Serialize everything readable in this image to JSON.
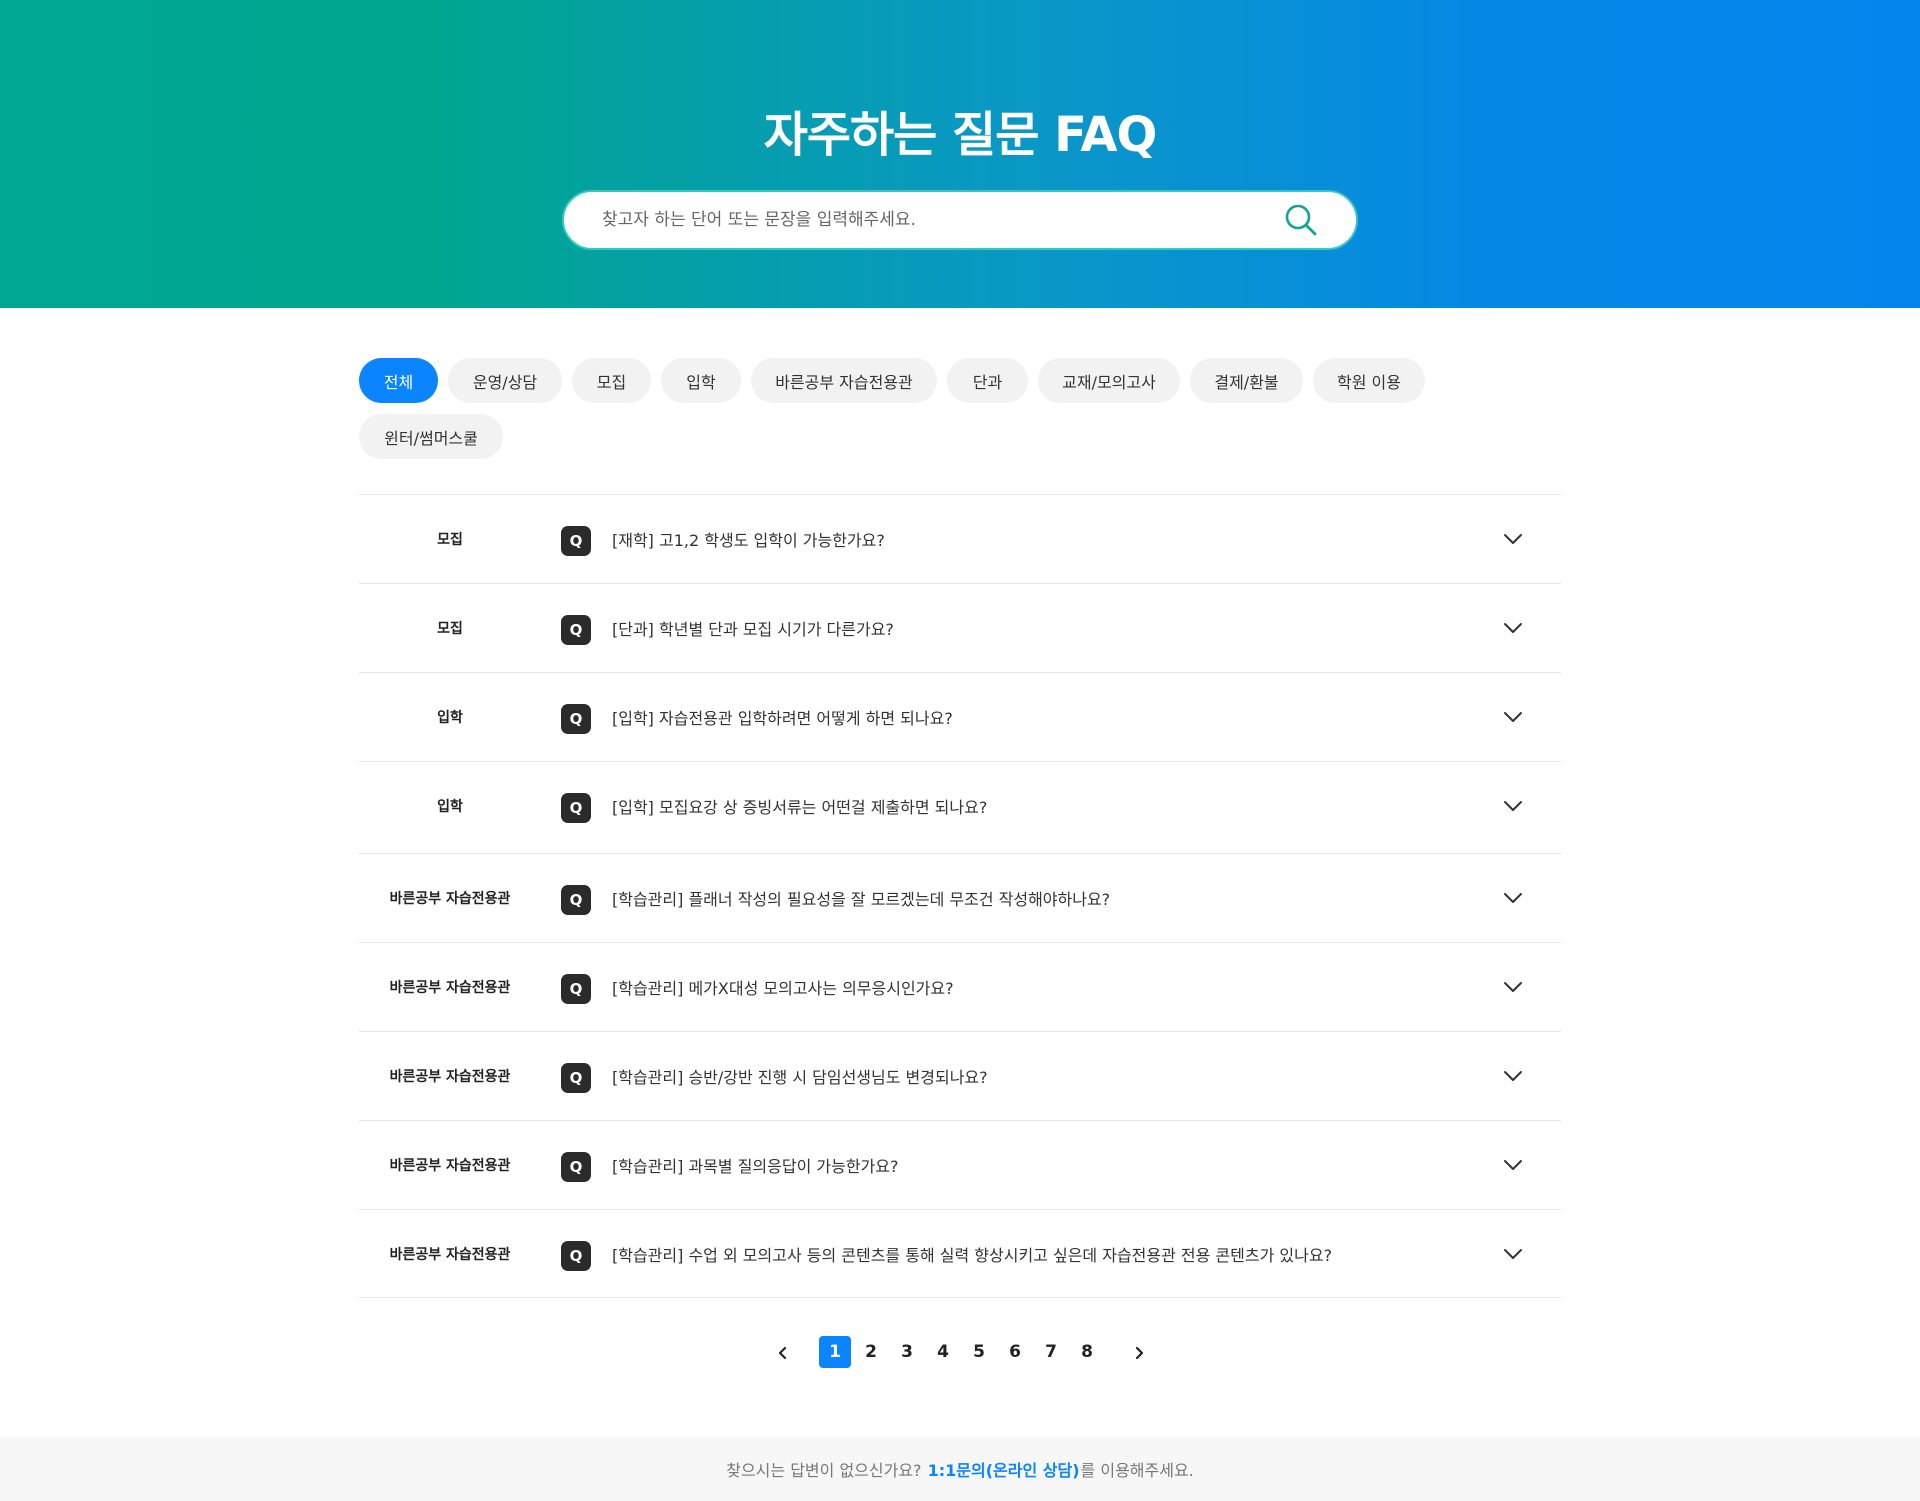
{
  "hero": {
    "title": "자주하는 질문 FAQ",
    "search_placeholder": "찾고자 하는 단어 또는 문장을 입력해주세요.",
    "search_icon": "search-icon"
  },
  "categories": [
    {
      "label": "전체",
      "active": true
    },
    {
      "label": "운영/상담",
      "active": false
    },
    {
      "label": "모집",
      "active": false
    },
    {
      "label": "입학",
      "active": false
    },
    {
      "label": "바른공부 자습전용관",
      "active": false
    },
    {
      "label": "단과",
      "active": false
    },
    {
      "label": "교재/모의고사",
      "active": false
    },
    {
      "label": "결제/환불",
      "active": false
    },
    {
      "label": "학원 이용",
      "active": false
    },
    {
      "label": "윈터/썸머스쿨",
      "active": false
    }
  ],
  "faq": {
    "badge": "Q",
    "items": [
      {
        "category": "모집",
        "question": "[재학] 고1,2 학생도 입학이 가능한가요?"
      },
      {
        "category": "모집",
        "question": "[단과] 학년별 단과 모집 시기가 다른가요?"
      },
      {
        "category": "입학",
        "question": "[입학] 자습전용관 입학하려면 어떻게 하면 되나요?"
      },
      {
        "category": "입학",
        "question": "[입학] 모집요강 상 증빙서류는 어떤걸 제출하면 되나요?"
      },
      {
        "category": "바른공부 자습전용관",
        "question": "[학습관리] 플래너 작성의 필요성을 잘 모르겠는데 무조건 작성해야하나요?"
      },
      {
        "category": "바른공부 자습전용관",
        "question": "[학습관리] 메가X대성 모의고사는 의무응시인가요?"
      },
      {
        "category": "바른공부 자습전용관",
        "question": "[학습관리] 승반/강반 진행 시 담임선생님도 변경되나요?"
      },
      {
        "category": "바른공부 자습전용관",
        "question": "[학습관리] 과목별 질의응답이 가능한가요?"
      },
      {
        "category": "바른공부 자습전용관",
        "question": "[학습관리] 수업 외 모의고사 등의 콘텐츠를 통해 실력 향상시키고 싶은데 자습전용관 전용 콘텐츠가 있나요?"
      }
    ]
  },
  "pagination": {
    "pages": [
      "1",
      "2",
      "3",
      "4",
      "5",
      "6",
      "7",
      "8"
    ],
    "current": "1",
    "prev_icon": "chevron-left-icon",
    "next_icon": "chevron-right-icon"
  },
  "footer": {
    "prefix": "찾으시는 답변이 없으신가요?",
    "link": "1:1문의(온라인 상담)",
    "suffix": "를 이용해주세요."
  },
  "colors": {
    "accent": "#0a84ff",
    "hero_start": "#00a793",
    "hero_end": "#0485ee",
    "badge": "#2b2b2b"
  }
}
